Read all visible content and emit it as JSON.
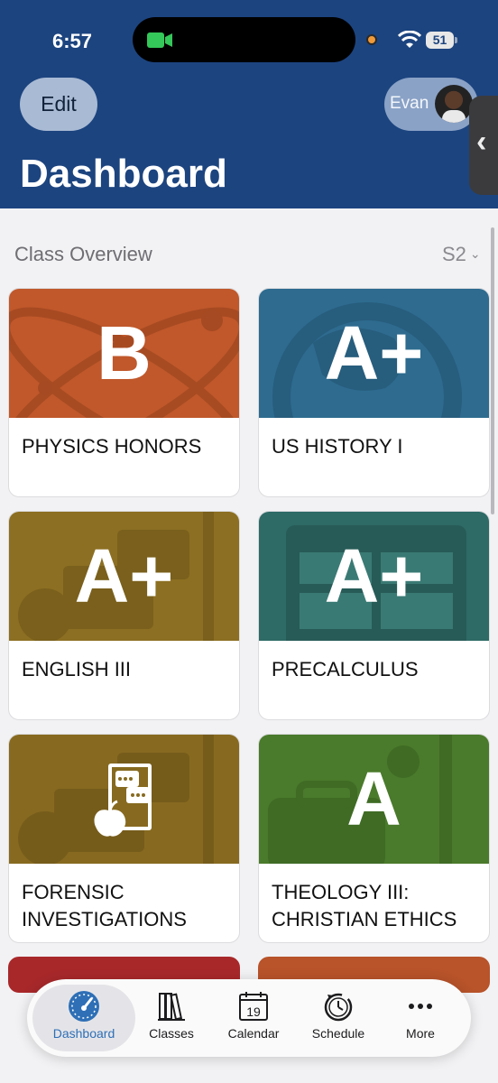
{
  "status_bar": {
    "time": "6:57",
    "battery": "51"
  },
  "header": {
    "edit_label": "Edit",
    "user_name": "Evan",
    "title": "Dashboard"
  },
  "overview": {
    "section_title": "Class Overview",
    "term": "S2"
  },
  "classes": [
    {
      "name": "PHYSICS HONORS",
      "grade": "B",
      "color": "#c0582b"
    },
    {
      "name": "US HISTORY I",
      "grade": "A+",
      "color": "#2e6b8f"
    },
    {
      "name": "ENGLISH III",
      "grade": "A+",
      "color": "#8c6f22"
    },
    {
      "name": "PRECALCULUS",
      "grade": "A+",
      "color": "#2e6a66"
    },
    {
      "name": "FORENSIC INVESTIGATIONS",
      "grade": "",
      "icon": "books-apple-icon",
      "color": "#876a20"
    },
    {
      "name": "THEOLOGY III: CHRISTIAN ETHICS",
      "grade": "A",
      "color": "#4a7a2b"
    }
  ],
  "partial_cards": [
    {
      "color": "#a8282a"
    },
    {
      "color": "#b8532a"
    }
  ],
  "tabbar": {
    "active": "dashboard",
    "tabs": [
      {
        "id": "dashboard",
        "label": "Dashboard",
        "icon": "gauge-icon"
      },
      {
        "id": "classes",
        "label": "Classes",
        "icon": "books-icon"
      },
      {
        "id": "calendar",
        "label": "Calendar",
        "icon": "calendar-icon",
        "day": "19"
      },
      {
        "id": "schedule",
        "label": "Schedule",
        "icon": "clock-icon"
      },
      {
        "id": "more",
        "label": "More",
        "icon": "more-icon"
      }
    ]
  },
  "colors": {
    "header": "#1c447f",
    "accent": "#2e6fb6"
  }
}
